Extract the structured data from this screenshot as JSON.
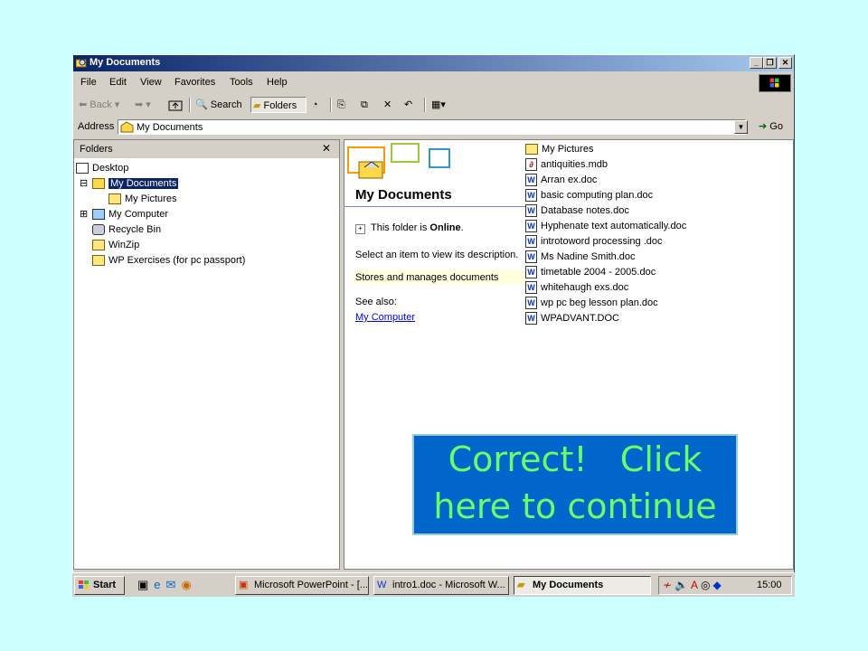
{
  "window": {
    "title": "My Documents"
  },
  "menu": [
    "File",
    "Edit",
    "View",
    "Favorites",
    "Tools",
    "Help"
  ],
  "toolbar": {
    "back": "Back",
    "search": "Search",
    "folders": "Folders"
  },
  "address": {
    "label": "Address",
    "value": "My Documents",
    "go": "Go"
  },
  "folders_pane": {
    "title": "Folders",
    "close": "✕",
    "items": [
      {
        "label": "Desktop"
      },
      {
        "label": "My Documents"
      },
      {
        "label": "My Pictures"
      },
      {
        "label": "My Computer"
      },
      {
        "label": "Recycle Bin"
      },
      {
        "label": "WinZip"
      },
      {
        "label": "WP Exercises (for pc passport)"
      }
    ]
  },
  "info_pane": {
    "heading": "My Documents",
    "folder_status_prefix": "This folder is ",
    "folder_status_value": "Online",
    "folder_status_suffix": ".",
    "select_hint": "Select an item to view its description.",
    "description": "Stores and manages documents",
    "see_also": "See also:",
    "link": "My Computer"
  },
  "files": [
    {
      "name": "My Pictures",
      "type": "folder"
    },
    {
      "name": "antiquities.mdb",
      "type": "mdb"
    },
    {
      "name": "Arran ex.doc",
      "type": "doc"
    },
    {
      "name": "basic computing plan.doc",
      "type": "doc"
    },
    {
      "name": "Database notes.doc",
      "type": "doc"
    },
    {
      "name": "Hyphenate text automatically.doc",
      "type": "doc"
    },
    {
      "name": "introtoword processing .doc",
      "type": "doc"
    },
    {
      "name": "Ms Nadine Smith.doc",
      "type": "doc"
    },
    {
      "name": "timetable 2004 - 2005.doc",
      "type": "doc"
    },
    {
      "name": "whitehaugh exs.doc",
      "type": "doc"
    },
    {
      "name": "wp pc beg lesson plan.doc",
      "type": "doc"
    },
    {
      "name": "WPADVANT.DOC",
      "type": "doc"
    }
  ],
  "taskbar": {
    "start": "Start",
    "tasks": [
      "Microsoft PowerPoint - [...",
      "intro1.doc - Microsoft W...",
      "My Documents"
    ],
    "clock": "15:00"
  },
  "overlay": {
    "line1": "Correct!   Click",
    "line2": "here to continue"
  }
}
